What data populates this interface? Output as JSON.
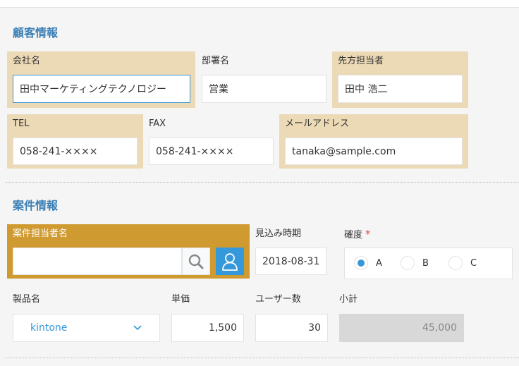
{
  "customer_section": {
    "title": "顧客情報",
    "company": {
      "label": "会社名",
      "value": "田中マーケティングテクノロジー"
    },
    "department": {
      "label": "部署名",
      "value": "営業"
    },
    "contact_person": {
      "label": "先方担当者",
      "value": "田中 浩二"
    },
    "tel": {
      "label": "TEL",
      "value": "058-241-××××"
    },
    "fax": {
      "label": "FAX",
      "value": "058-241-××××"
    },
    "email": {
      "label": "メールアドレス",
      "value": "tanaka@sample.com"
    }
  },
  "deal_section": {
    "title": "案件情報",
    "owner": {
      "label": "案件担当者名",
      "value": ""
    },
    "expected_date": {
      "label": "見込み時期",
      "value": "2018-08-31"
    },
    "certainty": {
      "label": "確度",
      "required_mark": "*",
      "options": [
        "A",
        "B",
        "C"
      ],
      "selected": "A"
    },
    "product": {
      "label": "製品名",
      "value": "kintone"
    },
    "unit_price": {
      "label": "単価",
      "value": "1,500"
    },
    "users": {
      "label": "ユーザー数",
      "value": "30"
    },
    "subtotal": {
      "label": "小計",
      "value": "45,000"
    }
  },
  "colors": {
    "accent": "#3498db",
    "title": "#3b7fb5",
    "highlight": "#ecd9b5",
    "highlight_strong": "#cf9a30"
  }
}
